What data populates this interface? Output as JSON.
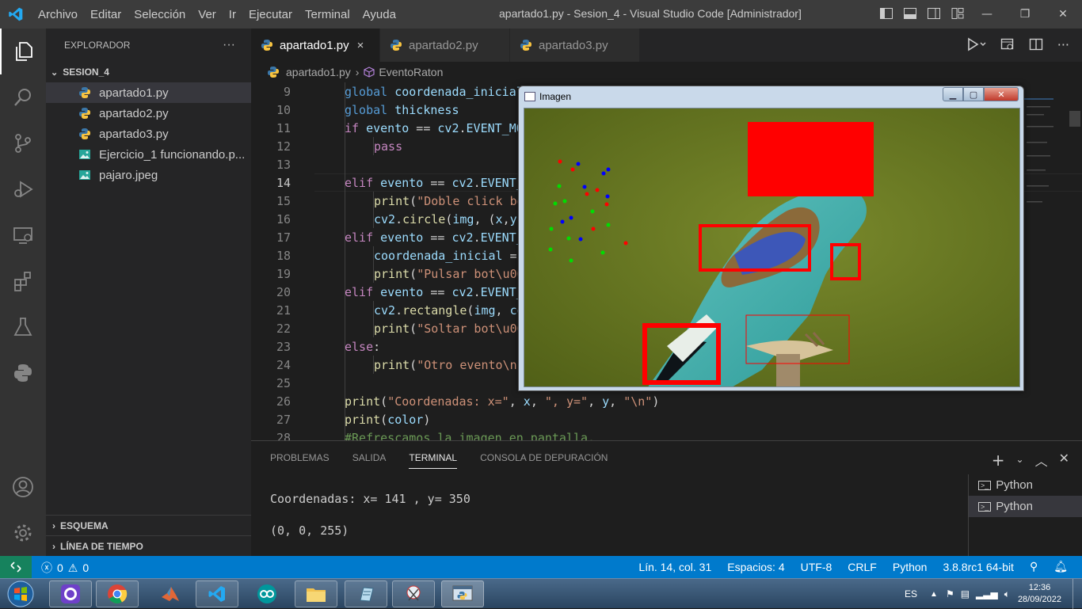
{
  "titlebar": {
    "menu": [
      "Archivo",
      "Editar",
      "Selección",
      "Ver",
      "Ir",
      "Ejecutar",
      "Terminal",
      "Ayuda"
    ],
    "title": "apartado1.py - Sesion_4 - Visual Studio Code [Administrador]"
  },
  "sidebar": {
    "header": "EXPLORADOR",
    "more": "···",
    "folder": "SESION_4",
    "files": [
      {
        "name": "apartado1.py",
        "type": "python"
      },
      {
        "name": "apartado2.py",
        "type": "python"
      },
      {
        "name": "apartado3.py",
        "type": "python"
      },
      {
        "name": "Ejercicio_1 funcionando.p...",
        "type": "image"
      },
      {
        "name": "pajaro.jpeg",
        "type": "image"
      }
    ],
    "outline": "ESQUEMA",
    "timeline": "LÍNEA DE TIEMPO"
  },
  "tabs": [
    {
      "label": "apartado1.py",
      "close": "×"
    },
    {
      "label": "apartado2.py"
    },
    {
      "label": "apartado3.py"
    }
  ],
  "breadcrumb": {
    "file": "apartado1.py",
    "separator": "›",
    "symbol": "EventoRaton"
  },
  "code": {
    "line_numbers": [
      "9",
      "10",
      "11",
      "12",
      "13",
      "14",
      "15",
      "16",
      "17",
      "18",
      "19",
      "20",
      "21",
      "22",
      "23",
      "24",
      "25",
      "26",
      "27",
      "28"
    ],
    "current_line": "14"
  },
  "panel": {
    "tabs": [
      "PROBLEMAS",
      "SALIDA",
      "TERMINAL",
      "CONSOLA DE DEPURACIÓN"
    ],
    "active_tab": "TERMINAL",
    "terminal_lines": [
      "Coordenadas: x= 141 , y= 350",
      "(0, 0, 255)"
    ],
    "terminals": [
      "Python",
      "Python"
    ]
  },
  "statusbar": {
    "errors": "0",
    "warnings": "0",
    "position": "Lín. 14, col. 31",
    "spaces": "Espacios: 4",
    "encoding": "UTF-8",
    "eol": "CRLF",
    "language": "Python",
    "interpreter": "3.8.8rc1 64-bit"
  },
  "image_window": {
    "title": "Imagen"
  },
  "taskbar": {
    "lang": "ES",
    "time": "12:36",
    "date": "28/09/2022"
  },
  "colors": {
    "accent": "#007acc",
    "remote": "#16825d",
    "drawn_shapes": "#ff0000"
  }
}
